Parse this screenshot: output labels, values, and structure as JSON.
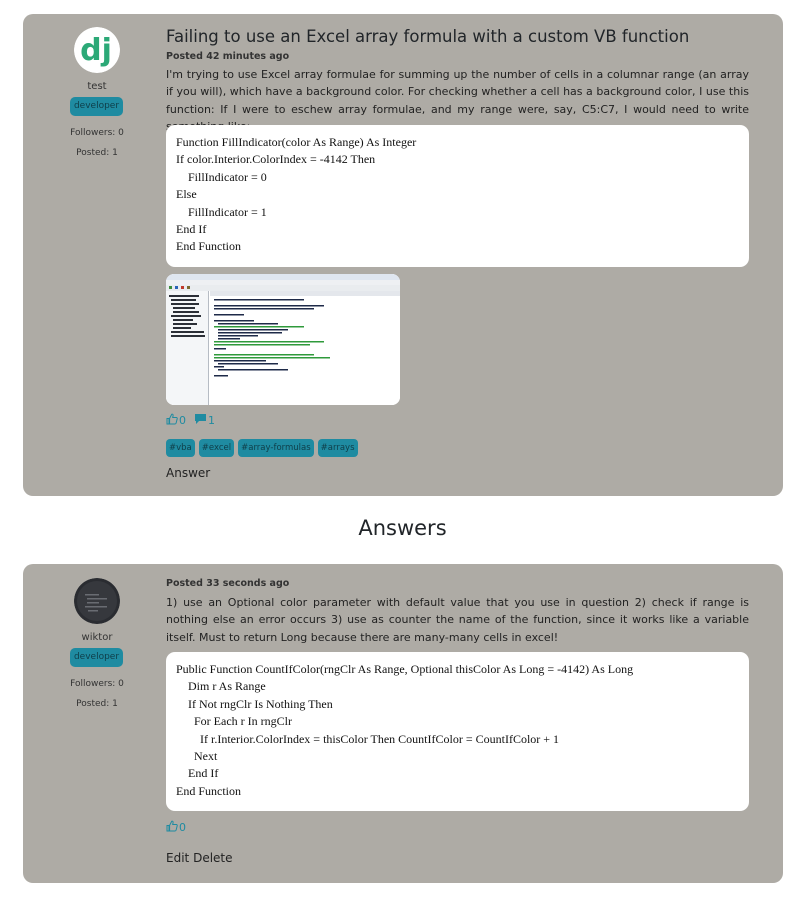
{
  "question": {
    "title": "Failing to use an Excel array formula with a custom VB function",
    "posted": "Posted 42 minutes ago",
    "body": "I'm trying to use Excel array formulae for summing up the number of cells in a columnar range (an array if you will), which have a background color. For checking whether a cell has a background color, I use this function: If I were to eschew array formulae, and my range were, say, C5:C7, I would need to write something like:",
    "code": [
      "Function FillIndicator(color As Range) As Integer",
      "If color.Interior.ColorIndex = -4142 Then",
      "    FillIndicator = 0",
      "Else",
      "    FillIndicator = 1",
      "End If",
      "End Function"
    ],
    "likes": "0",
    "comments": "1",
    "tags": [
      "#vba",
      "#excel",
      "#array-formulas",
      "#arrays"
    ],
    "answer_link": "Answer",
    "author": {
      "avatar_text": "dj",
      "username": "test",
      "role": "developer",
      "followers": "Followers: 0",
      "posted": "Posted: 1"
    }
  },
  "answers_heading": "Answers",
  "answer": {
    "posted": "Posted 33 seconds ago",
    "body": "1) use an Optional color parameter with default value that you use in question 2) check if range is nothing else an error occurs 3) use as counter the name of the function, since it works like a variable itself. Must to return Long because there are many-many cells in excel!",
    "code": [
      "Public Function CountIfColor(rngClr As Range, Optional thisColor As Long = -4142) As Long",
      "    Dim r As Range",
      "    If Not rngClr Is Nothing Then",
      "      For Each r In rngClr",
      "        If r.Interior.ColorIndex = thisColor Then CountIfColor = CountIfColor + 1",
      "      Next",
      "    End If",
      "End Function"
    ],
    "likes": "0",
    "edit_label": "Edit",
    "delete_label": "Delete",
    "author": {
      "username": "wiktor",
      "role": "developer",
      "followers": "Followers: 0",
      "posted": "Posted: 1"
    }
  },
  "colors": {
    "card_bg": "#aeaba5",
    "accent": "#1f8ba1",
    "django_green": "#2ba977"
  },
  "icons": [
    "thumbs-up-icon",
    "comment-icon"
  ]
}
